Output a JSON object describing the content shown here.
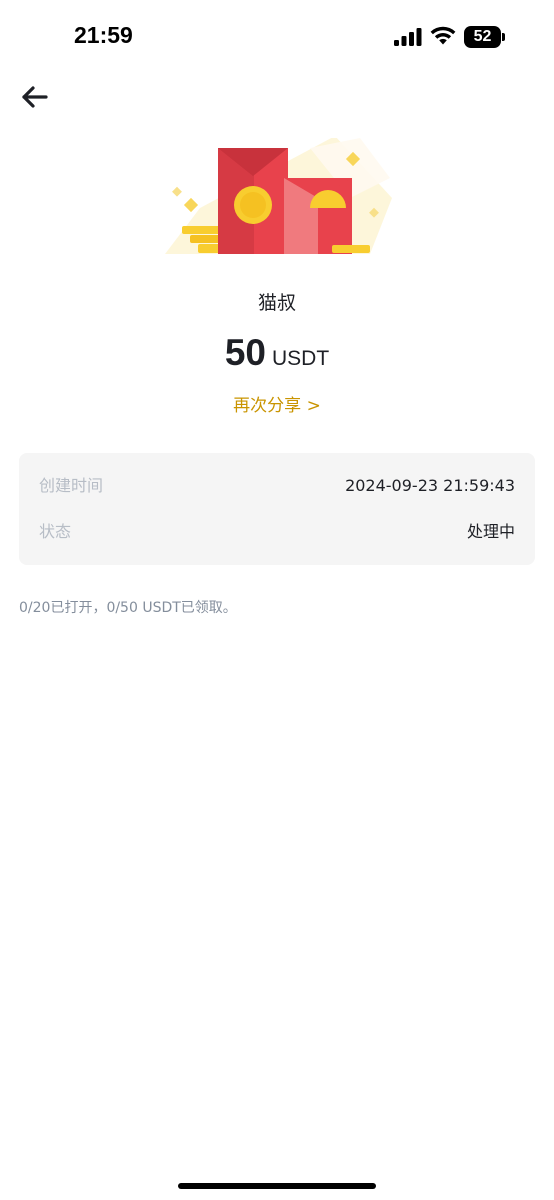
{
  "status_bar": {
    "time": "21:59",
    "battery": "52"
  },
  "red_packet": {
    "sender": "猫叔",
    "amount": "50",
    "unit": "USDT",
    "share_again": "再次分享 >"
  },
  "details": [
    {
      "label": "创建时间",
      "value": "2024-09-23 21:59:43"
    },
    {
      "label": "状态",
      "value": "处理中"
    }
  ],
  "summary": "0/20已打开，0/50 USDT已领取。",
  "colors": {
    "accent": "#c99400",
    "packet_red": "#e8424c",
    "coin_gold": "#f8cd2f",
    "card_bg": "#f5f5f5"
  },
  "icons": {
    "back": "arrow-left-icon",
    "signal": "cellular-signal-icon",
    "wifi": "wifi-icon",
    "battery": "battery-icon",
    "hero": "red-packet-illustration"
  }
}
